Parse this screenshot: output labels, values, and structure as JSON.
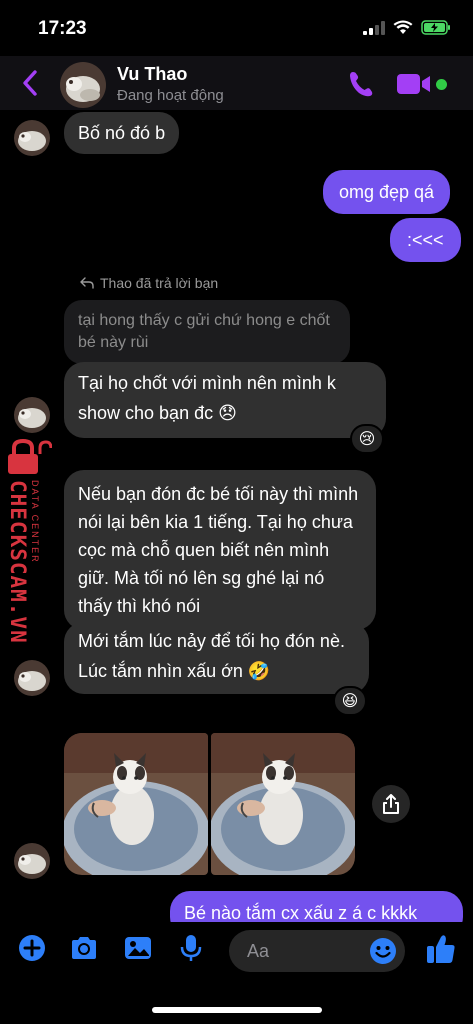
{
  "status_bar": {
    "time": "17:23"
  },
  "header": {
    "contact_name": "Vu Thao",
    "status": "Đang hoạt động"
  },
  "messages": {
    "m1": "Bố nó đó b",
    "m2": "omg đẹp qá",
    "m3": ":<<<",
    "reply_label": "Thao đã trả lời bạn",
    "quoted": "tại hong thấy c gửi chứ hong e chốt bé này rùi",
    "m4": "Tại họ chốt với mình nên mình k show cho bạn đc 😞",
    "m4_reaction": "😢",
    "m5": "Nếu bạn đón đc bé tối này thì mình nói lại bên kia 1 tiếng. Tại họ chưa cọc mà chỗ quen biết nên mình giữ. Mà tối nó lên sg ghé lại nó thấy thì khó nói",
    "m6": "Mới tắm lúc nảy để tối họ đón nè. Lúc tắm nhìn xấu ớn 🤣",
    "m6_reaction": "😆",
    "m7": "Bé nào tắm cx xấu z á c kkkk"
  },
  "watermark": {
    "brand": "CHECKSCAM.VN",
    "sub": "DATA CENTER"
  },
  "composer": {
    "placeholder": "Aa"
  },
  "colors": {
    "accent": "#a33ff5",
    "outgoing": "#7452ee",
    "incoming": "#303030",
    "composer_icons": "#2d7ff9",
    "online": "#31cc46"
  }
}
